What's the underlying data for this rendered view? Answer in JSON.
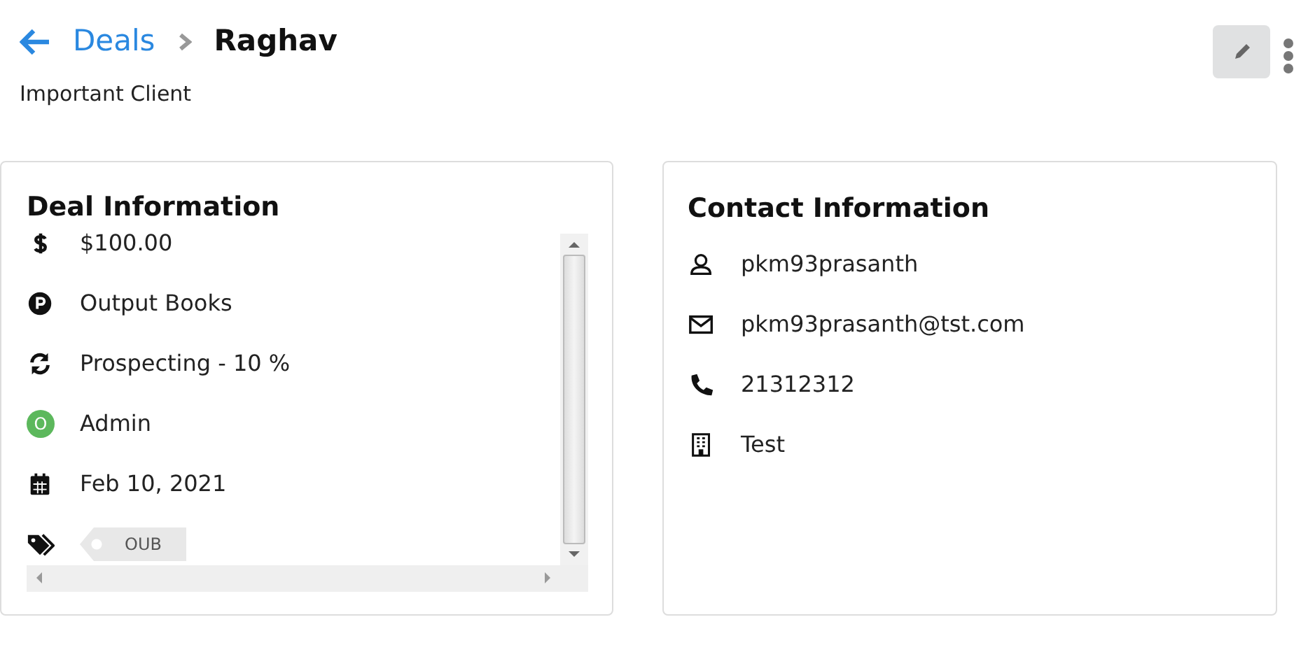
{
  "breadcrumb": {
    "parent": "Deals",
    "current": "Raghav"
  },
  "subtitle": "Important Client",
  "deal_information": {
    "title": "Deal Information",
    "rows": [
      {
        "kind": "amount",
        "text": "$100.00"
      },
      {
        "kind": "company",
        "text": "Output Books"
      },
      {
        "kind": "stage",
        "text": "Prospecting - 10 %"
      },
      {
        "kind": "owner",
        "text": "Admin",
        "avatar": "O",
        "color": "#5cb85c"
      },
      {
        "kind": "date",
        "text": "Feb 10, 2021"
      },
      {
        "kind": "tags",
        "tags": [
          "OUB"
        ]
      }
    ]
  },
  "contact_information": {
    "title": "Contact Information",
    "rows": [
      {
        "kind": "person",
        "text": "pkm93prasanth"
      },
      {
        "kind": "email",
        "text": "pkm93prasanth@tst.com"
      },
      {
        "kind": "phone",
        "text": "21312312"
      },
      {
        "kind": "organization",
        "text": "Test"
      }
    ]
  }
}
